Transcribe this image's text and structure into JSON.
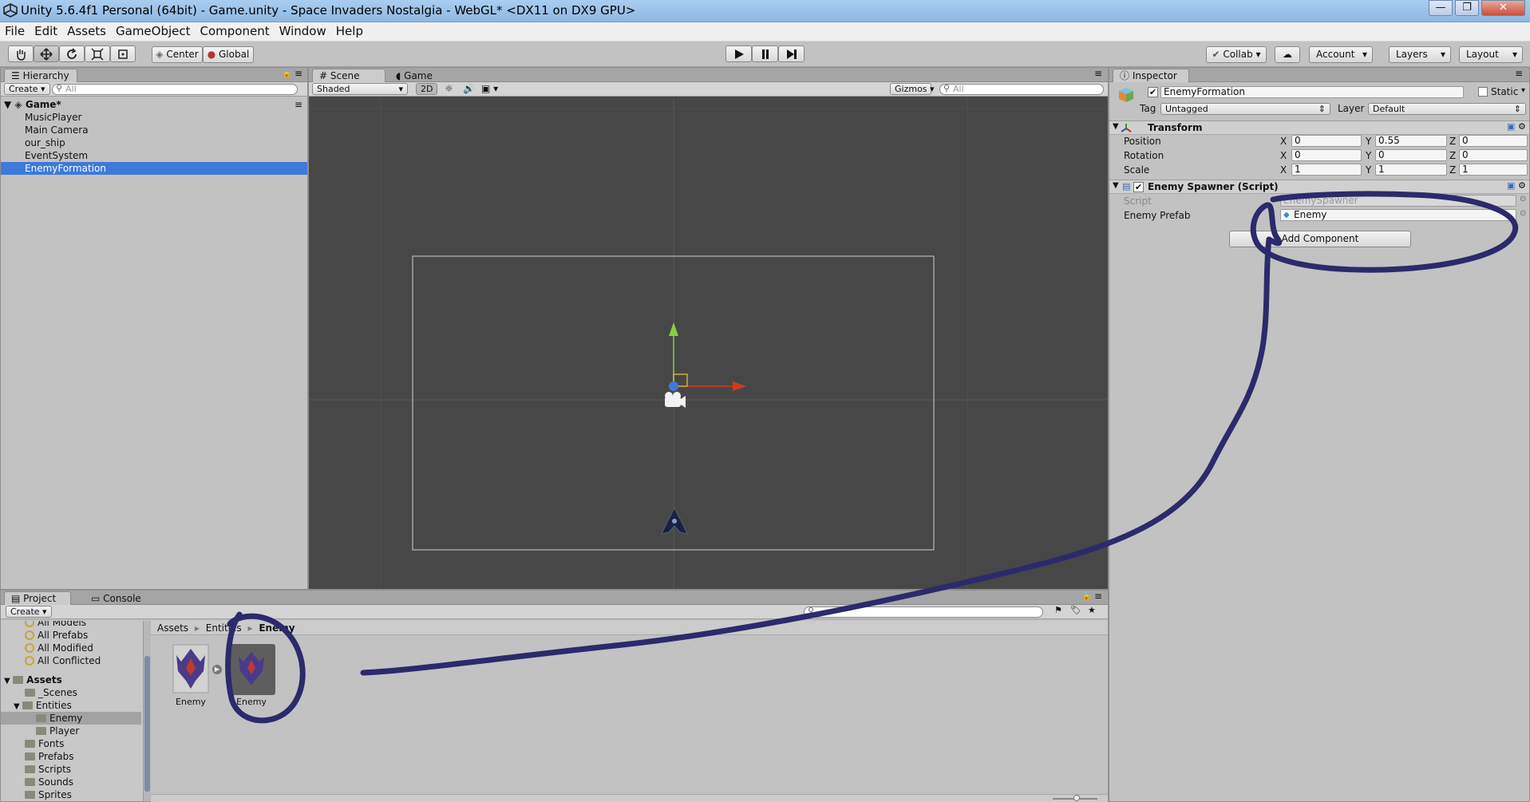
{
  "window": {
    "title": "Unity 5.6.4f1 Personal (64bit) - Game.unity - Space Invaders Nostalgia - WebGL* <DX11 on DX9 GPU>",
    "minimize": "—",
    "maximize": "❐",
    "close": "✕"
  },
  "menu": [
    "File",
    "Edit",
    "Assets",
    "GameObject",
    "Component",
    "Window",
    "Help"
  ],
  "toolbar": {
    "center_label": "Center",
    "global_label": "Global",
    "collab_label": "Collab ▾",
    "account_label": "Account",
    "layers_label": "Layers",
    "layout_label": "Layout"
  },
  "hierarchy": {
    "tab": "Hierarchy",
    "create": "Create",
    "search_placeholder": "All",
    "scene_name": "Game*",
    "items": [
      "MusicPlayer",
      "Main Camera",
      "our_ship",
      "EventSystem",
      "EnemyFormation"
    ],
    "selected": "EnemyFormation"
  },
  "scene": {
    "tab_scene": "Scene",
    "tab_game": "Game",
    "shading": "Shaded",
    "mode_2d": "2D",
    "gizmos": "Gizmos",
    "search_placeholder": "All"
  },
  "inspector": {
    "tab": "Inspector",
    "object_name": "EnemyFormation",
    "static_label": "Static",
    "tag_label": "Tag",
    "tag_value": "Untagged",
    "layer_label": "Layer",
    "layer_value": "Default",
    "transform": {
      "title": "Transform",
      "rows": [
        {
          "label": "Position",
          "x": "0",
          "y": "0.55",
          "z": "0"
        },
        {
          "label": "Rotation",
          "x": "0",
          "y": "0",
          "z": "0"
        },
        {
          "label": "Scale",
          "x": "1",
          "y": "1",
          "z": "1"
        }
      ]
    },
    "spawner": {
      "title": "Enemy Spawner (Script)",
      "script_label": "Script",
      "script_value": "EnemySpawner",
      "prefab_label": "Enemy Prefab",
      "prefab_value": "Enemy"
    },
    "add_component": "Add Component"
  },
  "project": {
    "tab_project": "Project",
    "tab_console": "Console",
    "create": "Create",
    "favorites": [
      "All Models",
      "All Prefabs",
      "All Modified",
      "All Conflicted"
    ],
    "assets_root": "Assets",
    "tree": [
      {
        "name": "_Scenes",
        "level": 1
      },
      {
        "name": "Entities",
        "level": 1
      },
      {
        "name": "Enemy",
        "level": 2
      },
      {
        "name": "Player",
        "level": 2
      },
      {
        "name": "Fonts",
        "level": 1
      },
      {
        "name": "Prefabs",
        "level": 1
      },
      {
        "name": "Scripts",
        "level": 1
      },
      {
        "name": "Sounds",
        "level": 1
      },
      {
        "name": "Sprites",
        "level": 1
      }
    ],
    "breadcrumb": [
      "Assets",
      "Entities",
      "Enemy"
    ],
    "files": [
      "Enemy",
      "Enemy"
    ]
  },
  "colors": {
    "selection": "#3d7ad9",
    "annotation": "#2b2a6b",
    "scene_bg": "#474747"
  }
}
